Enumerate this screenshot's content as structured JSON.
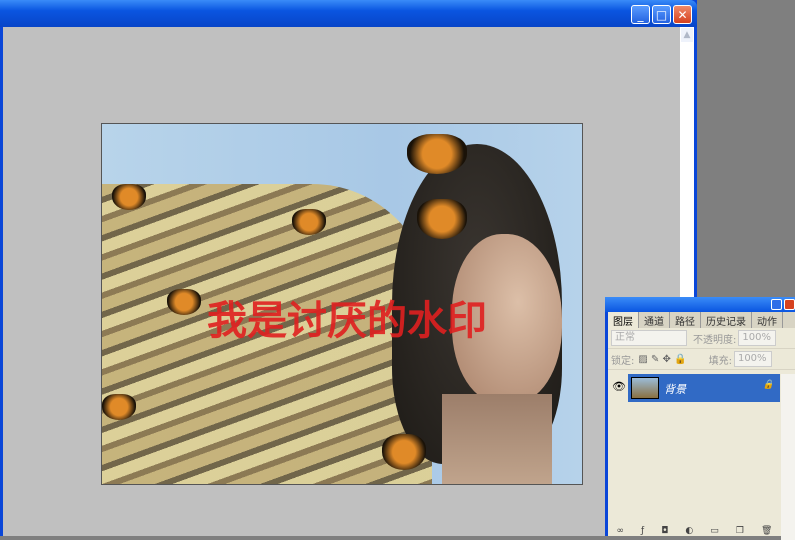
{
  "window": {
    "minimize": "_",
    "maximize": "□",
    "close": "✕"
  },
  "image": {
    "watermark": "我是讨厌的水印"
  },
  "layers_panel": {
    "tabs": [
      "图层",
      "通道",
      "路径",
      "历史记录",
      "动作"
    ],
    "blend_mode": "正常",
    "opacity_label": "不透明度:",
    "opacity_value": "100%",
    "lock_label": "锁定:",
    "fill_label": "填充:",
    "fill_value": "100%",
    "layers": [
      {
        "name": "背景",
        "locked": true,
        "visible": true
      }
    ]
  }
}
